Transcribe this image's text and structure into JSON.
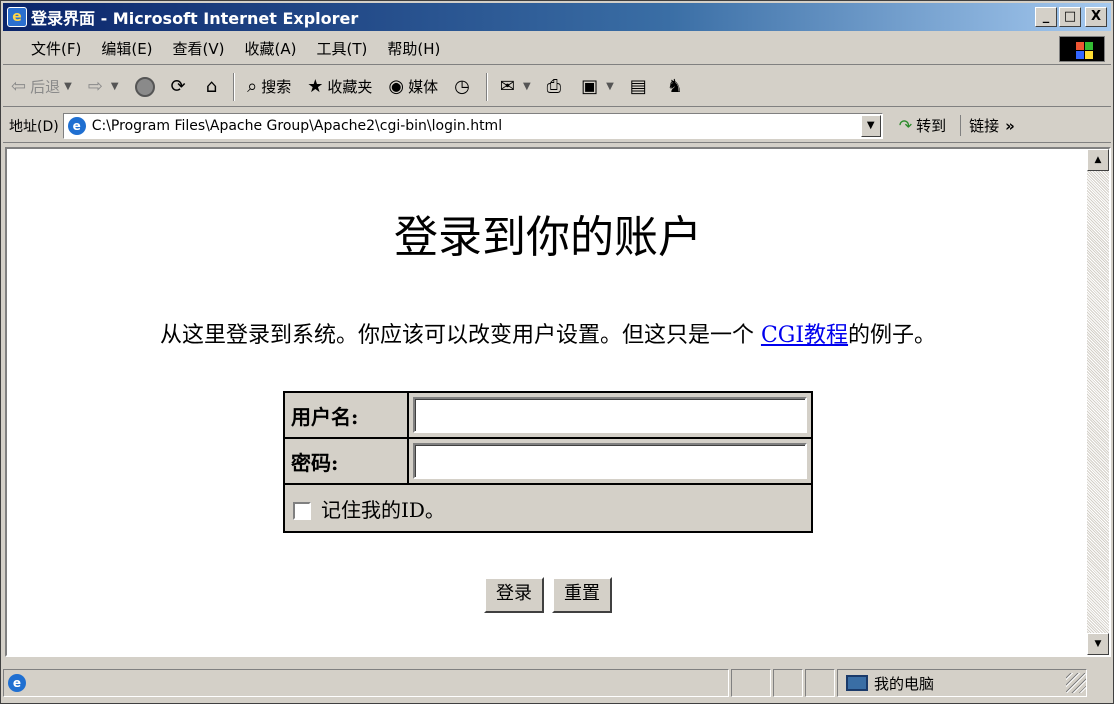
{
  "window": {
    "title": "登录界面 - Microsoft Internet Explorer",
    "minimize": "_",
    "maximize": "□",
    "close": "X"
  },
  "menu": [
    "文件(F)",
    "编辑(E)",
    "查看(V)",
    "收藏(A)",
    "工具(T)",
    "帮助(H)"
  ],
  "toolbar": {
    "back": "后退",
    "search": "搜索",
    "favorites": "收藏夹",
    "media": "媒体"
  },
  "address": {
    "label": "地址(D)",
    "value": "C:\\Program Files\\Apache Group\\Apache2\\cgi-bin\\login.html",
    "go": "转到",
    "links": "链接"
  },
  "page": {
    "heading": "登录到你的账户",
    "intro_before": "从这里登录到系统。你应该可以改变用户设置。但这只是一个 ",
    "intro_link": "CGI教程",
    "intro_after": "的例子。",
    "username_label": "用户名:",
    "username_value": "",
    "password_label": "密码:",
    "password_value": "",
    "remember_label": "记住我的ID。",
    "remember_checked": false,
    "login_button": "登录",
    "reset_button": "重置"
  },
  "status": {
    "zone": "我的电脑"
  }
}
